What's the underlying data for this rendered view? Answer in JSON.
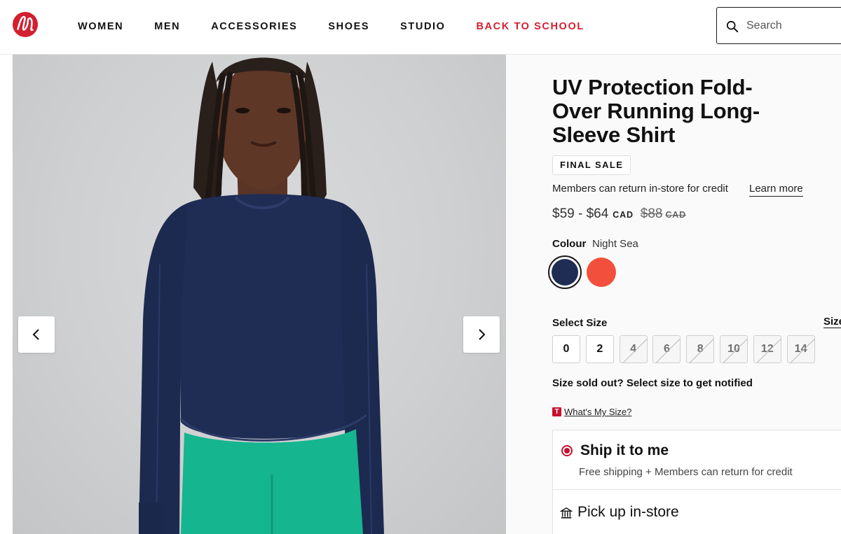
{
  "header": {
    "logo_icon": "lululemon-logo-icon",
    "brand_color": "#d31f30",
    "nav": [
      "WOMEN",
      "MEN",
      "ACCESSORIES",
      "SHOES",
      "STUDIO",
      "BACK TO SCHOOL"
    ],
    "promo_color": "#d31f30",
    "search": {
      "placeholder": "Search",
      "icon": "search-icon"
    }
  },
  "gallery": {
    "prev_icon": "chevron-left-icon",
    "next_icon": "chevron-right-icon"
  },
  "product": {
    "title": "UV Protection Fold-Over Running Long-Sleeve Shirt",
    "badge": "FINAL SALE",
    "members_text": "Members can return in-store for credit",
    "learn_more": "Learn more",
    "price": "$59 - $64",
    "currency": "CAD",
    "original_price": "$88",
    "original_currency": "CAD",
    "colour_label": "Colour",
    "colour_value": "Night Sea",
    "swatches": [
      {
        "name": "Night Sea",
        "color": "#1f2d55",
        "selected": true
      },
      {
        "name": "Coral",
        "color": "#f2503c",
        "selected": false
      }
    ],
    "select_size_label": "Select Size",
    "size_guide_label": "Size",
    "sizes": [
      {
        "label": "0",
        "available": true
      },
      {
        "label": "2",
        "available": true
      },
      {
        "label": "4",
        "available": false
      },
      {
        "label": "6",
        "available": false
      },
      {
        "label": "8",
        "available": false
      },
      {
        "label": "10",
        "available": false
      },
      {
        "label": "12",
        "available": false
      },
      {
        "label": "14",
        "available": false
      }
    ],
    "sold_out_text": "Size sold out? Select size to get notified",
    "whats_my_size_badge": "T",
    "whats_my_size": "What's My Size?",
    "shipping": {
      "ship_title": "Ship it to me",
      "ship_sub": "Free shipping + Members can return for credit",
      "pickup_title": "Pick up in-store",
      "pickup_icon": "store-icon"
    }
  }
}
